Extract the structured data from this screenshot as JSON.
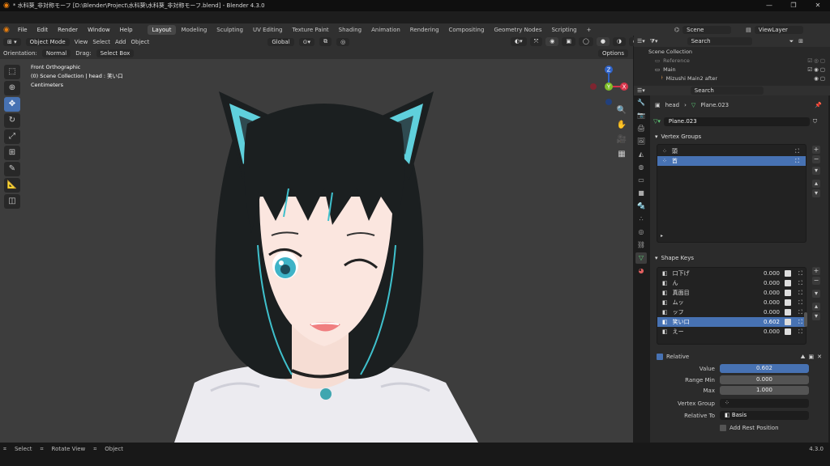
{
  "window": {
    "title": "* 水科葵_非対称モーフ [D:\\Blender\\Project\\水科葵\\水科葵_非対称モーフ.blend] - Blender 4.3.0"
  },
  "menu": [
    "File",
    "Edit",
    "Render",
    "Window",
    "Help"
  ],
  "workspaces": [
    "Layout",
    "Modeling",
    "Sculpting",
    "UV Editing",
    "Texture Paint",
    "Shading",
    "Animation",
    "Rendering",
    "Compositing",
    "Geometry Nodes",
    "Scripting"
  ],
  "active_workspace": "Layout",
  "scene": {
    "scene_label": "Scene",
    "view_layer": "ViewLayer"
  },
  "viewport_header": {
    "mode": "Object Mode",
    "items": [
      "View",
      "Select",
      "Add",
      "Object"
    ],
    "transform": "Global"
  },
  "viewport_subheader": {
    "orientation_label": "Orientation:",
    "orientation": "Normal",
    "drag_label": "Drag:",
    "drag": "Select Box",
    "options": "Options"
  },
  "viewport_info": {
    "view": "Front Orthographic",
    "collection": "(0) Scene Collection | head : 笑い口",
    "units": "Centimeters"
  },
  "gizmo": {
    "x": "X",
    "y": "Y",
    "z": "Z"
  },
  "outliner": {
    "search_placeholder": "Search",
    "rows": [
      "Scene Collection",
      "Reference",
      "Main",
      "Mizushi Main2 after"
    ]
  },
  "properties": {
    "search_placeholder": "Search",
    "breadcrumb": {
      "object": "head",
      "mesh": "Plane.023"
    },
    "mesh_name": "Plane.023",
    "vertex_groups_title": "Vertex Groups",
    "vertex_groups": [
      "頭",
      "首"
    ],
    "selected_vertex_group": 1,
    "shape_keys_title": "Shape Keys",
    "shape_keys": [
      {
        "name": "口下げ",
        "value": "0.000"
      },
      {
        "name": "ん",
        "value": "0.000"
      },
      {
        "name": "真面目",
        "value": "0.000"
      },
      {
        "name": "ムッ",
        "value": "0.000"
      },
      {
        "name": "ッフ",
        "value": "0.000"
      },
      {
        "name": "笑い口",
        "value": "0.602"
      },
      {
        "name": "えー",
        "value": "0.000"
      }
    ],
    "selected_shape_key": 5,
    "relative_label": "Relative",
    "value_label": "Value",
    "value": "0.602",
    "range_min_label": "Range Min",
    "range_min": "0.000",
    "max_label": "Max",
    "max": "1.000",
    "vertex_group_label": "Vertex Group",
    "relative_to_label": "Relative To",
    "relative_to": "Basis",
    "add_rest_position": "Add Rest Position"
  },
  "statusbar": {
    "select": "Select",
    "rotate": "Rotate View",
    "object": "Object",
    "version": "4.3.0"
  }
}
